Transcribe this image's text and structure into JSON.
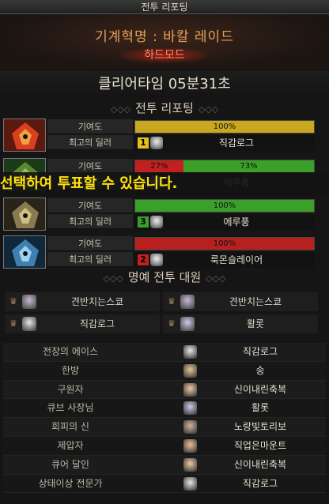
{
  "window": {
    "title": "전투 리포팅"
  },
  "header": {
    "raid_title": "기계혁명 : 바칼 레이드",
    "mode": "하드모드"
  },
  "clear": {
    "text": "클리어타임  05분31초"
  },
  "report_section": {
    "title": "전투 리포팅"
  },
  "labels": {
    "contribution": "기여도",
    "top_dealer": "최고의 딜러"
  },
  "bosses": [
    {
      "icon": "red-dragon-boss-icon",
      "contrib": [
        {
          "pct": 100,
          "text": "100%",
          "color": "#c9a820"
        }
      ],
      "dealer": {
        "rank": "1",
        "rank_color": "#e3c21a",
        "name": "직감로그"
      }
    },
    {
      "icon": "green-dragon-boss-icon",
      "contrib": [
        {
          "pct": 27,
          "text": "27%",
          "color": "#c02020"
        },
        {
          "pct": 73,
          "text": "73%",
          "color": "#3aa02a"
        }
      ],
      "dealer": {
        "rank": "",
        "rank_color": "#444",
        "name": "에루풍"
      }
    },
    {
      "icon": "gold-dragon-boss-icon",
      "contrib": [
        {
          "pct": 100,
          "text": "100%",
          "color": "#3aa02a"
        }
      ],
      "dealer": {
        "rank": "3",
        "rank_color": "#3aa02a",
        "name": "에루풍"
      }
    },
    {
      "icon": "ice-dragon-boss-icon",
      "contrib": [
        {
          "pct": 100,
          "text": "100%",
          "color": "#b82020"
        }
      ],
      "dealer": {
        "rank": "2",
        "rank_color": "#c02020",
        "name": "룩몬슬레이어"
      }
    }
  ],
  "vote_message": "선택하여 투표할 수 있습니다.",
  "honor_section": {
    "title": "명예 전투 대원"
  },
  "party": [
    {
      "name": "견반치는스쿄",
      "avatar": "#c8b8d8"
    },
    {
      "name": "견반치는스쿄",
      "avatar": "#c8b8d8"
    },
    {
      "name": "직감로그",
      "avatar": "#e8e8e8"
    },
    {
      "name": "활롯",
      "avatar": "#d0c8e8"
    }
  ],
  "awards": [
    {
      "title": "전장의 에이스",
      "winner": "직감로그",
      "avatar": "#e8e8e8"
    },
    {
      "title": "한방",
      "winner": "송",
      "avatar": "#e8c890"
    },
    {
      "title": "구원자",
      "winner": "신이내린축복",
      "avatar": "#f0c8a0"
    },
    {
      "title": "큐브 사장님",
      "winner": "활롯",
      "avatar": "#d0c8e8"
    },
    {
      "title": "회피의 신",
      "winner": "노랑빛토리보",
      "avatar": "#d8b0a0"
    },
    {
      "title": "제압자",
      "winner": "직업은마운트",
      "avatar": "#f0c090"
    },
    {
      "title": "큐어 달인",
      "winner": "신이내린축복",
      "avatar": "#f0c8a0"
    },
    {
      "title": "상태이상 전문가",
      "winner": "직감로그",
      "avatar": "#e8e8e8"
    }
  ]
}
